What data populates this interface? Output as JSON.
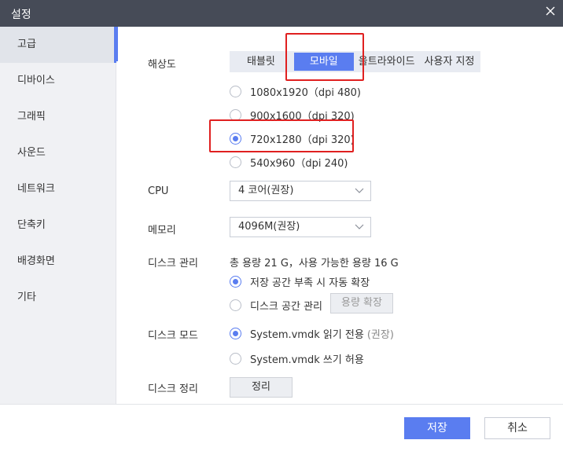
{
  "window": {
    "title": "설정"
  },
  "sidebar": {
    "items": [
      {
        "label": "고급",
        "active": true
      },
      {
        "label": "디바이스"
      },
      {
        "label": "그래픽"
      },
      {
        "label": "사운드"
      },
      {
        "label": "네트워크"
      },
      {
        "label": "단축키"
      },
      {
        "label": "배경화면"
      },
      {
        "label": "기타"
      }
    ]
  },
  "resolution": {
    "label": "해상도",
    "tabs": [
      "태블릿",
      "모바일",
      "울트라와이드",
      "사용자 지정"
    ],
    "active_tab": "모바일",
    "options": [
      {
        "label": "1080x1920（dpi 480)",
        "checked": false
      },
      {
        "label": "900x1600（dpi 320)",
        "checked": false
      },
      {
        "label": "720x1280（dpi 320)",
        "checked": true
      },
      {
        "label": "540x960（dpi 240)",
        "checked": false
      }
    ]
  },
  "cpu": {
    "label": "CPU",
    "value": "4 코어(권장)"
  },
  "memory": {
    "label": "메모리",
    "value": "4096M(권장)"
  },
  "disk": {
    "label": "디스크 관리",
    "info": "총 용량 21 G，사용 가능한 용량 16 G",
    "options": [
      {
        "label": "저장 공간 부족 시 자동 확장",
        "checked": true
      },
      {
        "label": "디스크 공간 관리",
        "checked": false
      }
    ],
    "expand_button": "용량 확장"
  },
  "disk_mode": {
    "label": "디스크 모드",
    "options": [
      {
        "label": "System.vmdk 읽기 전용",
        "suffix": "(권장)",
        "checked": true
      },
      {
        "label": "System.vmdk 쓰기 허용",
        "checked": false
      }
    ]
  },
  "disk_cleanup": {
    "label": "디스크 정리",
    "button": "정리"
  },
  "footer": {
    "save": "저장",
    "cancel": "취소"
  },
  "colors": {
    "accent": "#5a7df0",
    "titlebar": "#464b57",
    "sidebar": "#f0f1f4",
    "highlight": "#e02020"
  },
  "icons": {
    "close": "close-icon",
    "dropdown": "chevron-down-icon"
  }
}
